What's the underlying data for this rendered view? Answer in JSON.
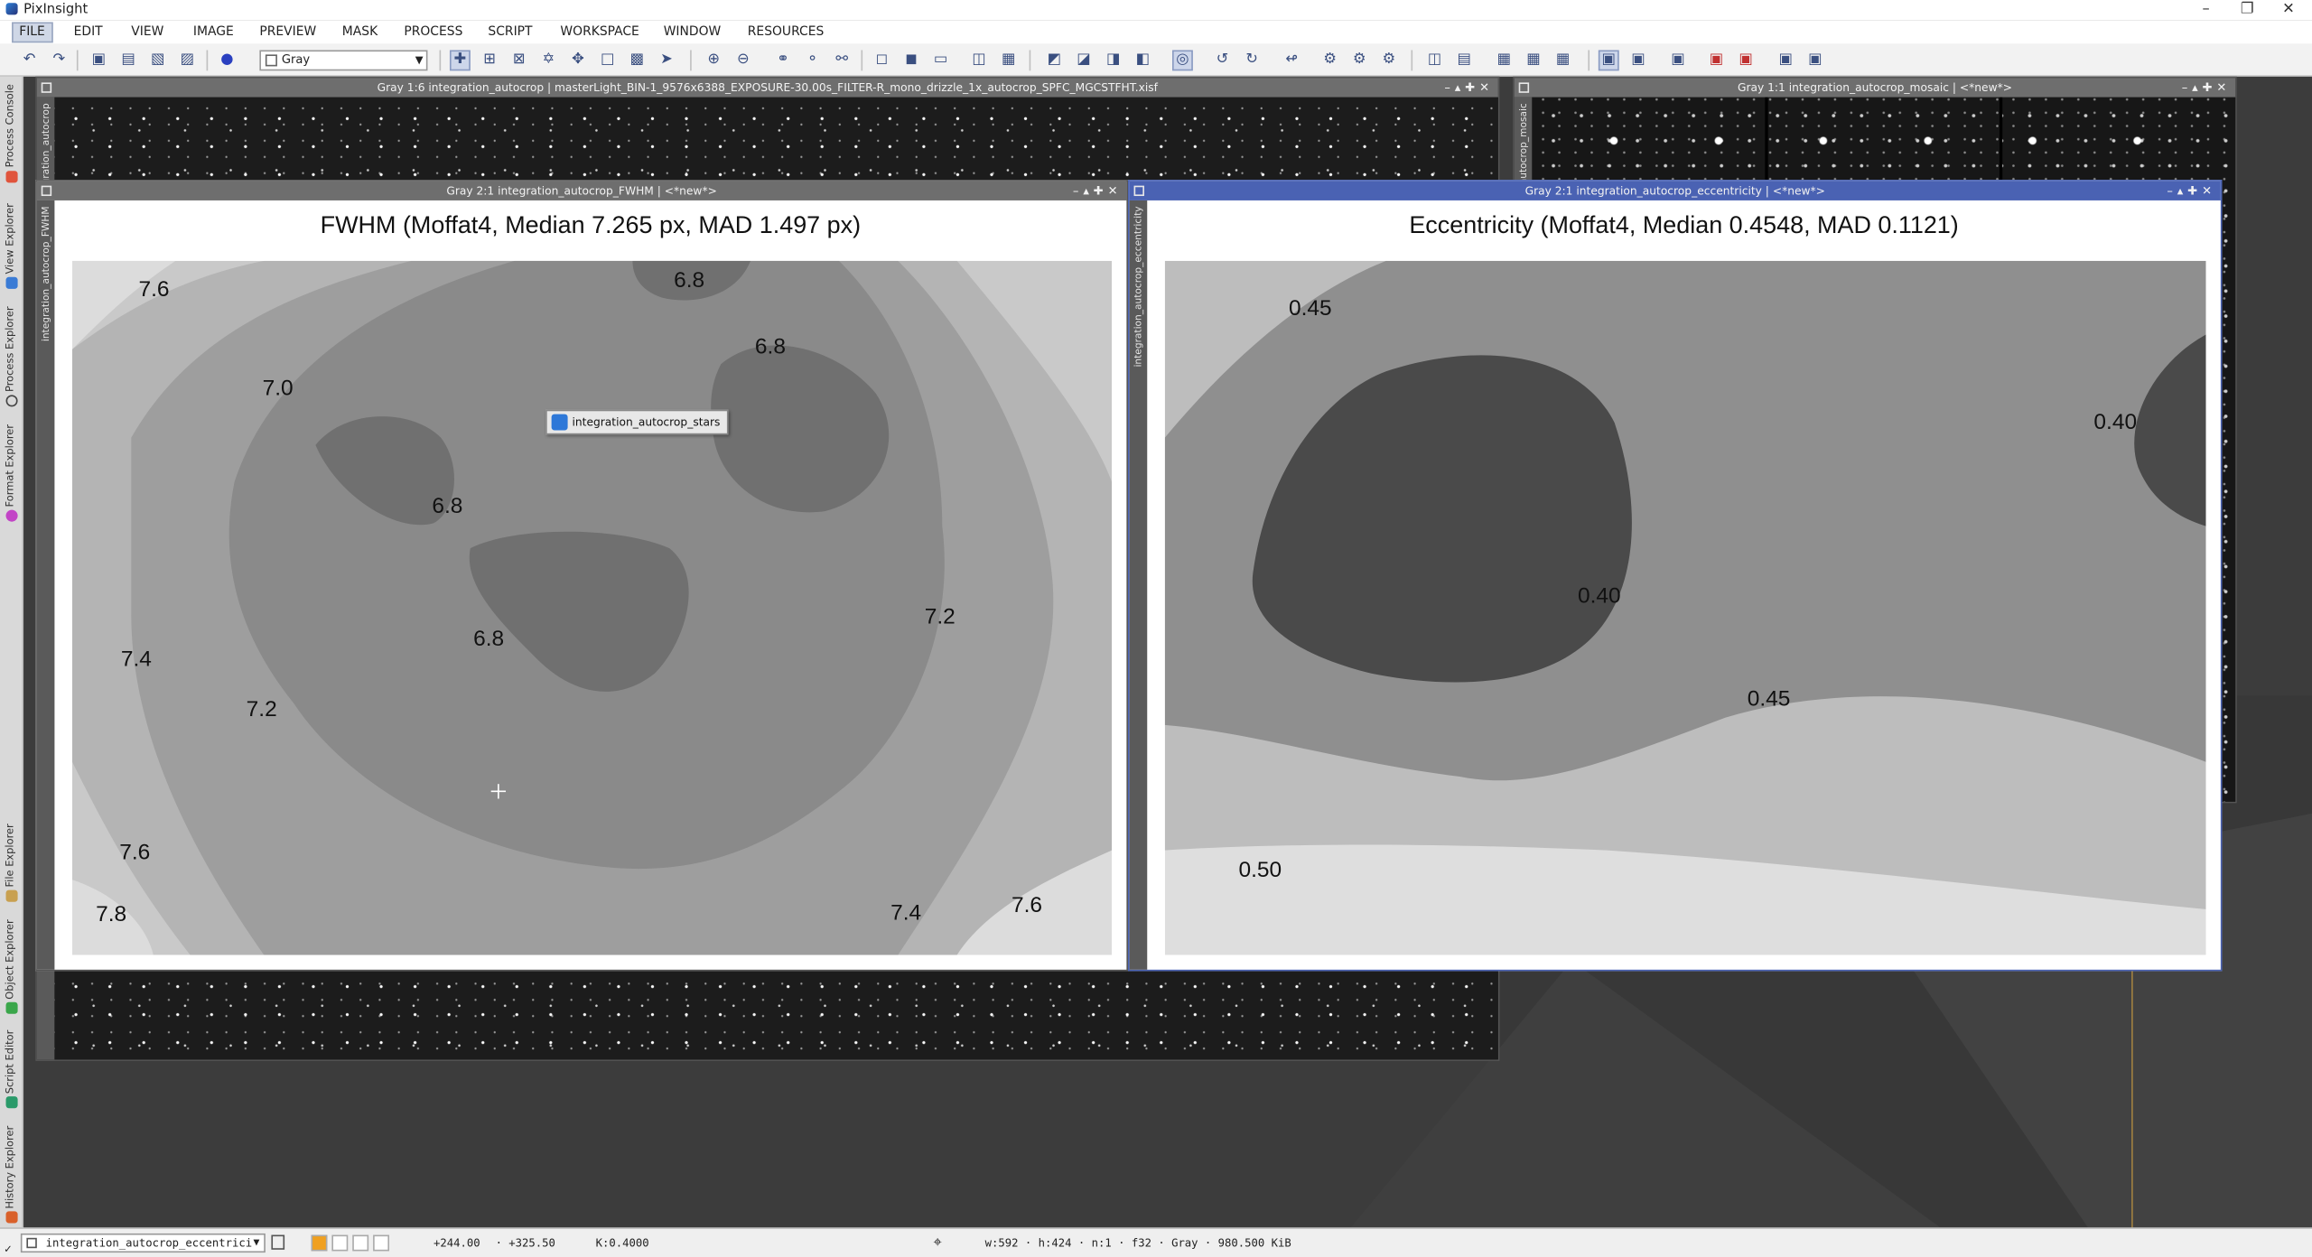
{
  "app": {
    "title": "PixInsight"
  },
  "menu": [
    "FILE",
    "EDIT",
    "VIEW",
    "IMAGE",
    "PREVIEW",
    "MASK",
    "PROCESS",
    "SCRIPT",
    "WORKSPACE",
    "WINDOW",
    "RESOURCES"
  ],
  "toolbar": {
    "colorspace_value": "Gray"
  },
  "sidebar": {
    "items": [
      {
        "label": "Process Console",
        "icon": "console-icon",
        "color": "#e0543c"
      },
      {
        "label": "View Explorer",
        "icon": "view-explorer-icon",
        "color": "#3a7bd5"
      },
      {
        "label": "Process Explorer",
        "icon": "process-explorer-icon",
        "color": "#555555"
      },
      {
        "label": "Format Explorer",
        "icon": "format-explorer-icon",
        "color": "#c244c6"
      },
      {
        "label": "File Explorer",
        "icon": "file-explorer-icon",
        "color": "#c8a050"
      },
      {
        "label": "Object Explorer",
        "icon": "object-explorer-icon",
        "color": "#3aa64a"
      },
      {
        "label": "Script Editor",
        "icon": "script-editor-icon",
        "color": "#2a9a6a"
      },
      {
        "label": "History Explorer",
        "icon": "history-explorer-icon",
        "color": "#d9602a"
      }
    ]
  },
  "windows": {
    "main_image": {
      "title": "Gray 1:6 integration_autocrop | masterLight_BIN-1_9576x6388_EXPOSURE-30.00s_FILTER-R_mono_drizzle_1x_autocrop_SPFC_MGCSTFHT.xisf",
      "tab_label": "integration_autocrop"
    },
    "mosaic": {
      "title": "Gray 1:1 integration_autocrop_mosaic | <*new*>",
      "tab_label": "integration_autocrop_mosaic"
    },
    "fwhm": {
      "title": "Gray 2:1 integration_autocrop_FWHM | <*new*>",
      "tab_label": "integration_autocrop_FWHM",
      "plot_title": "FWHM (Moffat4, Median 7.265 px, MAD 1.497 px)",
      "tooltip": "integration_autocrop_stars"
    },
    "eccentricity": {
      "title": "Gray 2:1 integration_autocrop_eccentricity | <*new*>",
      "tab_label": "integration_autocrop_eccentricity",
      "plot_title": "Eccentricity (Moffat4, Median 0.4548, MAD 0.1121)"
    }
  },
  "chart_data": [
    {
      "type": "heatmap",
      "title": "FWHM (Moffat4, Median 7.265 px, MAD 1.497 px)",
      "contour_labels": [
        "7.6",
        "6.8",
        "6.8",
        "7.0",
        "6.8",
        "6.8",
        "7.4",
        "7.2",
        "7.2",
        "7.6",
        "7.8",
        "7.4",
        "7.6"
      ]
    },
    {
      "type": "heatmap",
      "title": "Eccentricity (Moffat4, Median 0.4548, MAD 0.1121)",
      "contour_labels": [
        "0.45",
        "0.40",
        "0.40",
        "0.45",
        "0.50"
      ]
    }
  ],
  "statusbar": {
    "view_selector": "integration_autocrop_eccentrici",
    "cursor_x": "+244.00",
    "cursor_y": "+325.50",
    "k_value": "K:0.4000",
    "image_info": "w:592 · h:424 · n:1 · f32 · Gray · 980.500 KiB"
  }
}
